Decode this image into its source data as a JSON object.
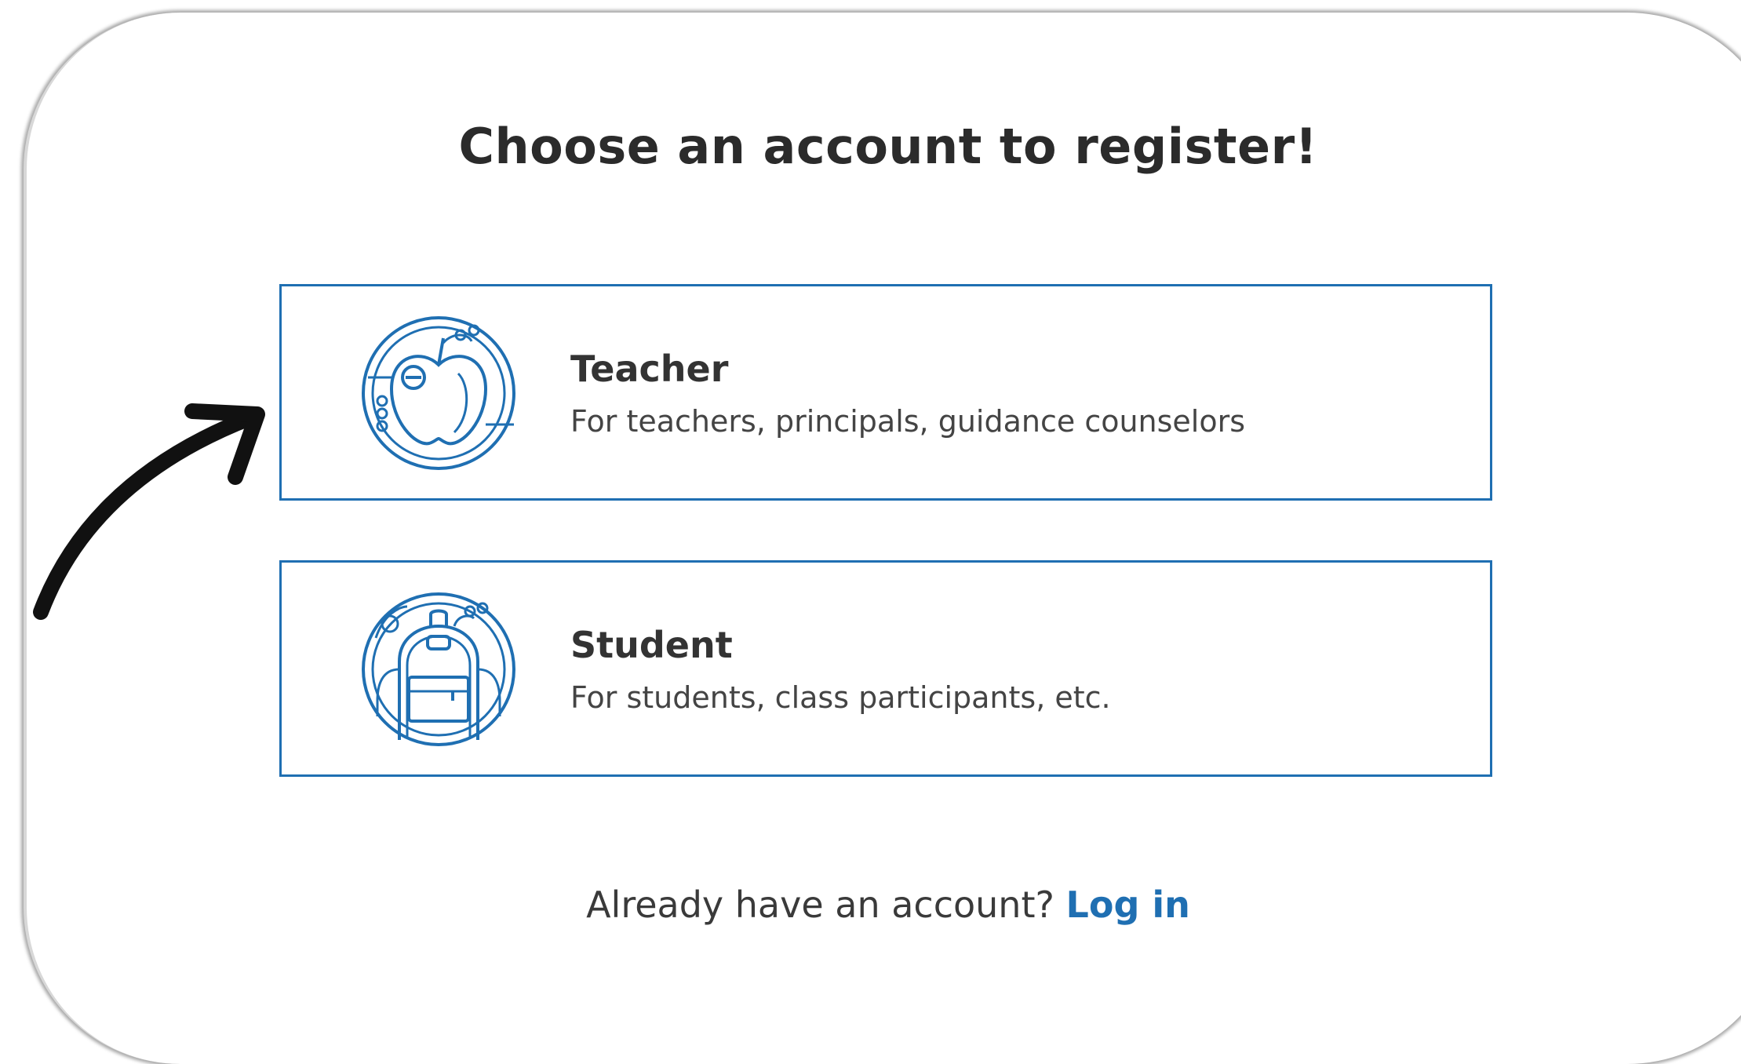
{
  "page": {
    "title": "Choose an account to register!"
  },
  "accounts": [
    {
      "label": "Teacher",
      "description": "For teachers, principals, guidance counselors",
      "icon": "apple-icon"
    },
    {
      "label": "Student",
      "description": "For students, class participants, etc.",
      "icon": "backpack-icon"
    }
  ],
  "footer": {
    "prompt": "Already have an account?",
    "login_label": "Log in"
  },
  "colors": {
    "accent": "#1f6fb2",
    "title": "#2b2b2b",
    "annotation_arrow": "#111111"
  }
}
